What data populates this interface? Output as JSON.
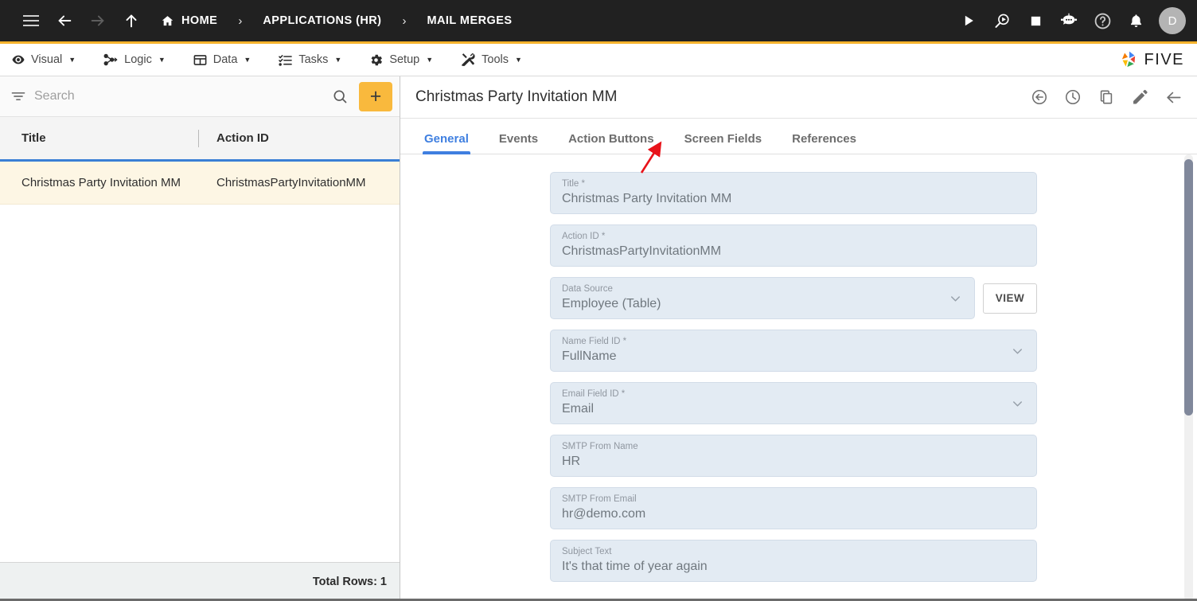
{
  "topbar": {
    "menu_icon": "hamburger-icon",
    "back_icon": "arrow-left-icon",
    "forward_icon": "arrow-right-icon",
    "up_icon": "arrow-up-icon",
    "breadcrumbs": [
      {
        "label": "HOME",
        "icon": "home-icon"
      },
      {
        "label": "APPLICATIONS (HR)",
        "icon": ""
      },
      {
        "label": "MAIL MERGES",
        "icon": ""
      }
    ],
    "separator": "›",
    "actions": [
      {
        "name": "run-icon",
        "glyph": "play"
      },
      {
        "name": "preview-icon",
        "glyph": "search-play"
      },
      {
        "name": "stop-icon",
        "glyph": "stop"
      },
      {
        "name": "chatbot-icon",
        "glyph": "robot"
      },
      {
        "name": "help-icon",
        "glyph": "question"
      },
      {
        "name": "notifications-icon",
        "glyph": "bell"
      }
    ],
    "avatar_initial": "D",
    "accent_color": "#f5b32c",
    "background": "#212121"
  },
  "menubar": {
    "items": [
      {
        "label": "Visual",
        "icon": "eye-icon"
      },
      {
        "label": "Logic",
        "icon": "flow-nodes-icon"
      },
      {
        "label": "Data",
        "icon": "table-icon"
      },
      {
        "label": "Tasks",
        "icon": "checklist-icon"
      },
      {
        "label": "Setup",
        "icon": "gear-icon"
      },
      {
        "label": "Tools",
        "icon": "tools-icon"
      }
    ],
    "caret": "▼",
    "logo_text": "FIVE"
  },
  "sidebar": {
    "search": {
      "placeholder": "Search",
      "value": ""
    },
    "filter_icon": "filter-icon",
    "search_icon": "search-icon",
    "add_button_label": "+",
    "add_button_color": "#f9b93d",
    "columns": [
      "Title",
      "Action ID"
    ],
    "rows": [
      {
        "title": "Christmas Party Invitation MM",
        "action_id": "ChristmasPartyInvitationMM"
      }
    ],
    "footer_label": "Total Rows: 1"
  },
  "detail": {
    "title": "Christmas Party Invitation MM",
    "header_actions": [
      {
        "name": "revert-icon",
        "glyph": "back-circle"
      },
      {
        "name": "history-icon",
        "glyph": "clock"
      },
      {
        "name": "duplicate-icon",
        "glyph": "copy"
      },
      {
        "name": "edit-icon",
        "glyph": "pencil"
      },
      {
        "name": "close-icon",
        "glyph": "arrow-left"
      }
    ],
    "tabs": [
      {
        "label": "General",
        "active": true
      },
      {
        "label": "Events",
        "active": false
      },
      {
        "label": "Action Buttons",
        "active": false
      },
      {
        "label": "Screen Fields",
        "active": false
      },
      {
        "label": "References",
        "active": false
      }
    ],
    "active_tab_color": "#3f7fe0",
    "fields": [
      {
        "label": "Title *",
        "value": "Christmas Party Invitation MM",
        "type": "text",
        "trailing": ""
      },
      {
        "label": "Action ID *",
        "value": "ChristmasPartyInvitationMM",
        "type": "text",
        "trailing": ""
      },
      {
        "label": "Data Source",
        "value": "Employee (Table)",
        "type": "select",
        "trailing": "VIEW"
      },
      {
        "label": "Name Field ID *",
        "value": "FullName",
        "type": "select",
        "trailing": ""
      },
      {
        "label": "Email Field ID *",
        "value": "Email",
        "type": "select",
        "trailing": ""
      },
      {
        "label": "SMTP From Name",
        "value": "HR",
        "type": "text",
        "trailing": ""
      },
      {
        "label": "SMTP From Email",
        "value": "hr@demo.com",
        "type": "text",
        "trailing": ""
      },
      {
        "label": "Subject Text",
        "value": "It's that time of year again",
        "type": "text",
        "trailing": ""
      }
    ],
    "view_button_label": "VIEW",
    "field_background": "#e3ebf3"
  },
  "annotation": {
    "arrow_color": "#e8131a",
    "points_at": "Screen Fields"
  }
}
